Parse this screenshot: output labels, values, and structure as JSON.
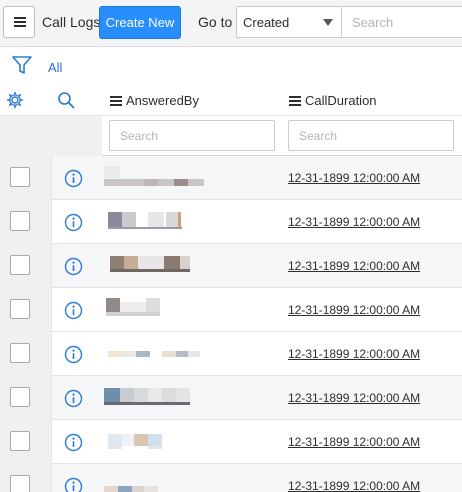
{
  "header": {
    "title": "Call Logs",
    "create_label": "Create New",
    "goto_label": "Go to",
    "goto_selected": "Created",
    "search_placeholder": "Search"
  },
  "filter": {
    "label": "All"
  },
  "columns": [
    {
      "label": "AnsweredBy"
    },
    {
      "label": "CallDuration"
    }
  ],
  "column_search": {
    "placeholder": "Search"
  },
  "rows": [
    {
      "call_duration": "12-31-1899 12:00:00 AM"
    },
    {
      "call_duration": "12-31-1899 12:00:00 AM"
    },
    {
      "call_duration": "12-31-1899 12:00:00 AM"
    },
    {
      "call_duration": "12-31-1899 12:00:00 AM"
    },
    {
      "call_duration": "12-31-1899 12:00:00 AM"
    },
    {
      "call_duration": "12-31-1899 12:00:00 AM"
    },
    {
      "call_duration": "12-31-1899 12:00:00 AM"
    },
    {
      "call_duration": "12-31-1899 12:00:00 AM"
    }
  ],
  "icons": {
    "menu": "hamburger-icon",
    "filter": "funnel-icon",
    "settings": "gear-icon",
    "search": "magnifier-icon",
    "info": "info-circle-icon"
  },
  "colors": {
    "accent": "#278efc",
    "link": "#2b6fd6",
    "icon_blue": "#2b7bd6"
  }
}
